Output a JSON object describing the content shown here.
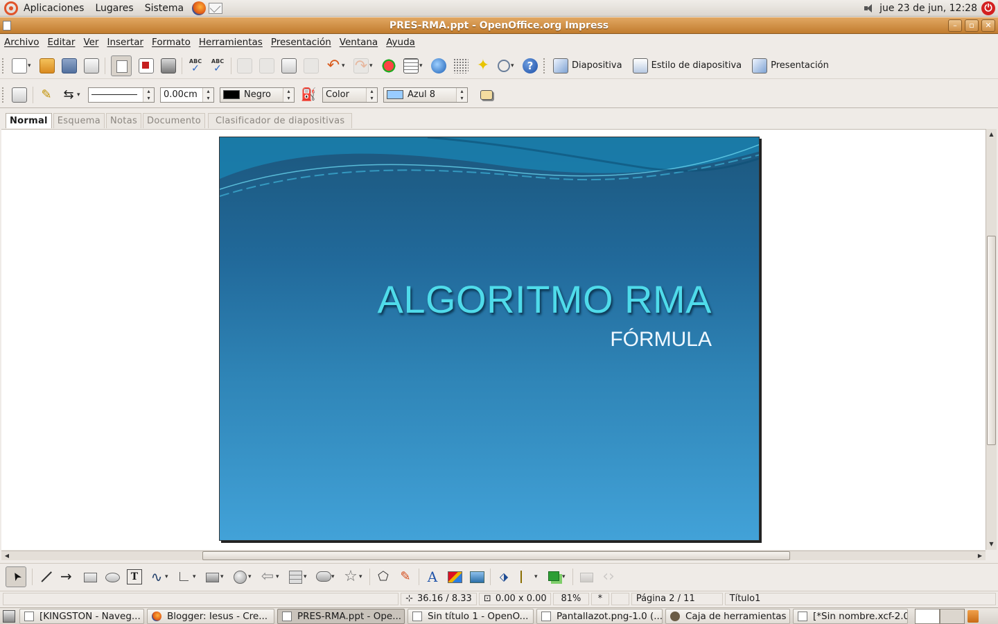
{
  "top_panel": {
    "menus": [
      "Aplicaciones",
      "Lugares",
      "Sistema"
    ],
    "clock": "jue 23 de jun, 12:28"
  },
  "window": {
    "title": "PRES-RMA.ppt - OpenOffice.org Impress",
    "controls": [
      "minimize",
      "maximize",
      "close"
    ]
  },
  "menu_bar": [
    "Archivo",
    "Editar",
    "Ver",
    "Insertar",
    "Formato",
    "Herramientas",
    "Presentación",
    "Ventana",
    "Ayuda"
  ],
  "standard_toolbar": {
    "slide_label": "Diapositiva",
    "slide_design_label": "Estilo de diapositiva",
    "presentation_label": "Presentación"
  },
  "line_toolbar": {
    "line_width": "0.00cm",
    "line_color": "Negro",
    "line_color_hex": "#000000",
    "area_style": "Color",
    "area_color": "Azul 8",
    "area_color_hex": "#99ccff"
  },
  "view_tabs": [
    "Normal",
    "Esquema",
    "Notas",
    "Documento",
    "Clasificador de diapositivas"
  ],
  "active_view": "Normal",
  "slide": {
    "title": "ALGORITMO RMA",
    "subtitle": "FÓRMULA",
    "title_color": "#4fdbea",
    "background_top": "#1c577d",
    "background_bottom": "#42a2d8"
  },
  "status_bar": {
    "position": "36.16 / 8.33",
    "size": "0.00 x 0.00",
    "zoom": "81%",
    "modified": "*",
    "page": "Página 2 / 11",
    "layout": "Título1"
  },
  "taskbar": {
    "tasks": [
      "[KINGSTON - Naveg...",
      "Blogger: Iesus - Cre...",
      "PRES-RMA.ppt - Ope...",
      "Sin título 1 - OpenO...",
      "Pantallazot.png-1.0 (...",
      "Caja de herramientas",
      "[*Sin nombre.xcf-2.0..."
    ]
  }
}
